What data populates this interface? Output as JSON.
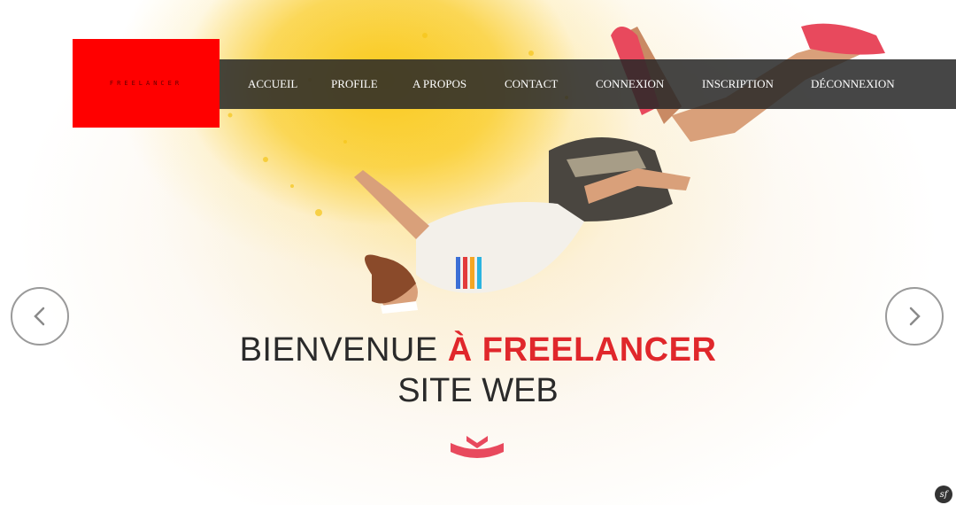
{
  "brand": {
    "logo_text": "FREELANCER",
    "logo_color": "#ff0000"
  },
  "nav": {
    "items": [
      "ACCUEIL",
      "PROFILE",
      "A PROPOS",
      "CONTACT",
      "CONNEXION",
      "INSCRIPTION",
      "DÉCONNEXION"
    ]
  },
  "hero": {
    "title_part1": "BIENVENUE ",
    "title_accent": "À FREELANCER",
    "subtitle": "SITE WEB",
    "accent_color": "#e0272b"
  },
  "carousel": {
    "prev_icon": "chevron-left-icon",
    "next_icon": "chevron-right-icon"
  },
  "footer": {
    "badge_icon": "symfony-icon",
    "badge_text": "sf"
  }
}
